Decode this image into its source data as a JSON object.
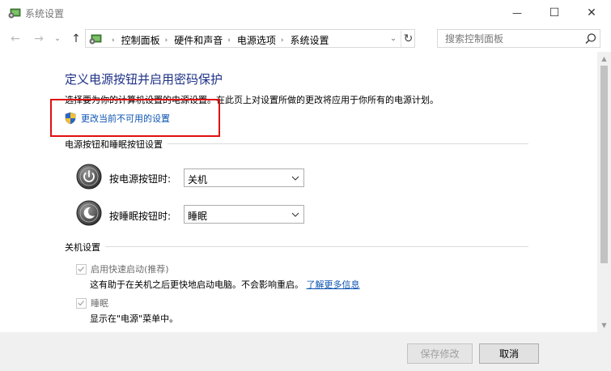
{
  "window": {
    "title": "系统设置",
    "icon": "control-panel-icon",
    "controls": {
      "minimize": "—",
      "maximize": "☐",
      "close": "✕"
    }
  },
  "nav": {
    "back": "←",
    "forward": "→",
    "recent": "⌄",
    "up": "↑"
  },
  "address": {
    "crumbs": [
      "控制面板",
      "硬件和声音",
      "电源选项",
      "系统设置"
    ],
    "separator": "›",
    "dropdown": "⌄",
    "refresh": "↻"
  },
  "search": {
    "placeholder": "搜索控制面板"
  },
  "content": {
    "title": "定义电源按钮并启用密码保护",
    "description": "选择要为你的计算机设置的电源设置。在此页上对设置所做的更改将应用于你所有的电源计划。",
    "change_link": "更改当前不可用的设置",
    "power_group": {
      "label": "电源按钮和睡眠按钮设置",
      "power_button": {
        "label": "按电源按钮时:",
        "value": "关机"
      },
      "sleep_button": {
        "label": "按睡眠按钮时:",
        "value": "睡眠"
      }
    },
    "shutdown_group": {
      "label": "关机设置",
      "fast_startup": {
        "label": "启用快速启动(推荐)",
        "checked": true,
        "desc": "这有助于在关机之后更快地启动电脑。不会影响重启。",
        "link": "了解更多信息"
      },
      "sleep": {
        "label": "睡眠",
        "checked": true,
        "desc": "显示在\"电源\"菜单中。"
      }
    }
  },
  "footer": {
    "save_label": "保存修改",
    "cancel_label": "取消"
  },
  "colors": {
    "title_blue": "#1e3287",
    "link_blue": "#0c54b2",
    "highlight_red": "#e01010"
  }
}
